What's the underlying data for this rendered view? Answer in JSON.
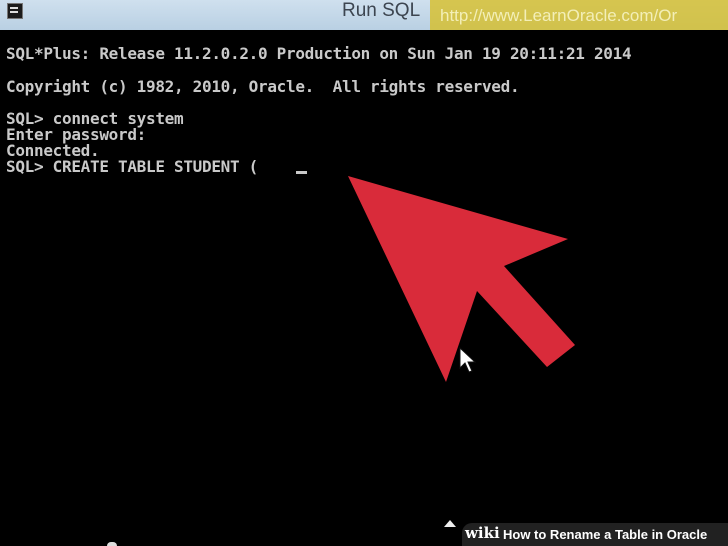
{
  "window": {
    "title": "Run SQL",
    "watermark_url": "http://www.LearnOracle.com/Or"
  },
  "console": {
    "lines": [
      "SQL*Plus: Release 11.2.0.2.0 Production on Sun Jan 19 20:11:21 2014",
      "Copyright (c) 1982, 2010, Oracle.  All rights reserved.",
      "SQL> connect system",
      "Enter password:",
      "Connected.",
      "SQL> CREATE TABLE STUDENT ("
    ]
  },
  "overlay": {
    "arrow_color": "#d92b3a",
    "pointer": "mouse-pointer-icon"
  },
  "footer": {
    "logo": "wiki",
    "caption": "How to Rename a Table in Oracle"
  }
}
